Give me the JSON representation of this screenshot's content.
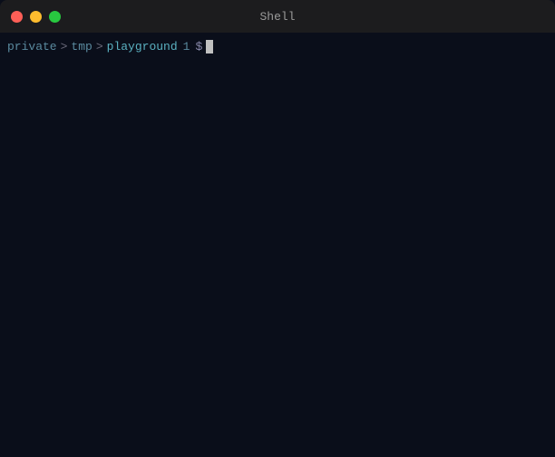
{
  "window": {
    "title": "Shell"
  },
  "titlebar": {
    "title": "Shell",
    "btn_close_label": "close",
    "btn_minimize_label": "minimize",
    "btn_maximize_label": "maximize"
  },
  "terminal": {
    "prompt": {
      "private": "private",
      "arrow1": ">",
      "tmp": "tmp",
      "arrow2": ">",
      "playground": "playground",
      "number": "1",
      "dollar": "$"
    }
  },
  "colors": {
    "background": "#0a0e1a",
    "titlebar": "#1c1c1e",
    "close": "#ff5f57",
    "minimize": "#febc2e",
    "maximize": "#28c840",
    "path_color": "#5a8a9f",
    "playground_color": "#5ab0c0",
    "cursor": "#c0c0c0"
  }
}
